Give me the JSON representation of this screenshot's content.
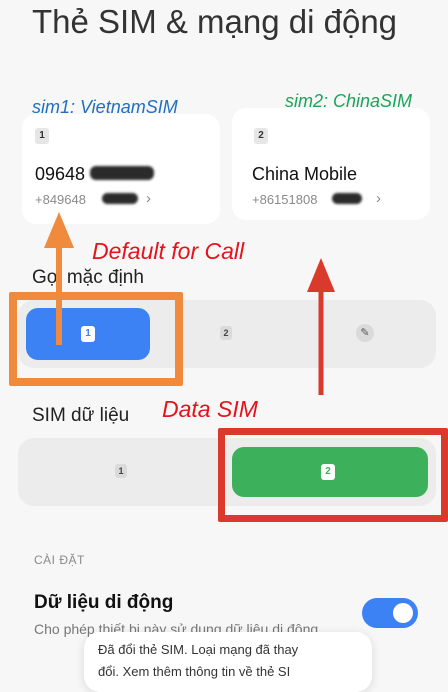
{
  "page": {
    "title": "Thẻ SIM & mạng di động"
  },
  "annotations": {
    "sim1_note": "sim1: VietnamSIM",
    "sim2_note": "sim2: ChinaSIM",
    "default_call": "Default for Call",
    "data_sim": "Data SIM"
  },
  "sims": [
    {
      "slot": "1",
      "name": "09648",
      "number": "+849648"
    },
    {
      "slot": "2",
      "name": "China Mobile",
      "number": "+86151808"
    }
  ],
  "default_call": {
    "label": "Gọi mặc định",
    "options": [
      "1",
      "2"
    ],
    "selected": "1"
  },
  "data_sim": {
    "label": "SIM dữ liệu",
    "options": [
      "1",
      "2"
    ],
    "selected": "2"
  },
  "settings": {
    "section_label": "CÀI ĐẶT",
    "mobile_data_title": "Dữ liệu di động",
    "mobile_data_desc": "Cho phép thiết bị này sử dụng dữ liệu di động",
    "mobile_data_enabled": true
  },
  "toast": {
    "line1": "Đã đổi thẻ SIM. Loại mạng đã thay",
    "line2": "đổi. Xem thêm thông tin về thẻ SI"
  },
  "colors": {
    "accent_blue": "#3d82f5",
    "data_green": "#3cb05a",
    "annotation_red": "#e3141b",
    "highlight_orange": "#f08a3c"
  }
}
